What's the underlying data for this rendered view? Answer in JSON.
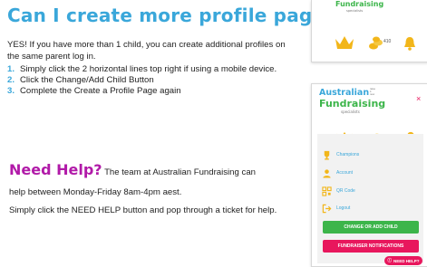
{
  "title": "Can I create more profile pages?",
  "intro": "YES! If you have more than 1 child, you can create additional profiles on the same parent log in.",
  "steps": [
    {
      "num": "1.",
      "text": "Simply click the 2 horizontal lines top right if using a mobile device."
    },
    {
      "num": "2.",
      "text": "Click the Change/Add Child Button"
    },
    {
      "num": "3.",
      "text": "Complete the Create a Profile Page again"
    }
  ],
  "help": {
    "heading": "Need Help?",
    "heading_rest": " The team at Australian Fundraising can",
    "line2": "help between Monday-Friday 8am-4pm aest.",
    "line3": "Simply click the NEED HELP button and pop through a ticket for help."
  },
  "phone_top": {
    "logo_word": "Fundraising",
    "logo_sub": "specialists",
    "points": "410"
  },
  "phone_menu": {
    "logo_line1": "Australian",
    "logo_line1_small": "raise\nit\nnow",
    "logo_line2": "Fundraising",
    "logo_sub": "specialists",
    "close": "×",
    "points": "410",
    "items": [
      {
        "label": "Champions",
        "icon": "trophy-icon"
      },
      {
        "label": "Account",
        "icon": "user-icon"
      },
      {
        "label": "QR Code",
        "icon": "qr-code-icon"
      },
      {
        "label": "Logout",
        "icon": "logout-icon"
      }
    ],
    "change_child": "CHANGE OR ADD CHILD",
    "notifications": "FUNDRAISER NOTIFICATIONS",
    "need_help": "NEED HELP?"
  },
  "colors": {
    "title": "#3aa7da",
    "help_heading": "#b11aa8",
    "green_button": "#3cb54a",
    "red_button": "#e8175d",
    "gold": "#f2b61a"
  }
}
